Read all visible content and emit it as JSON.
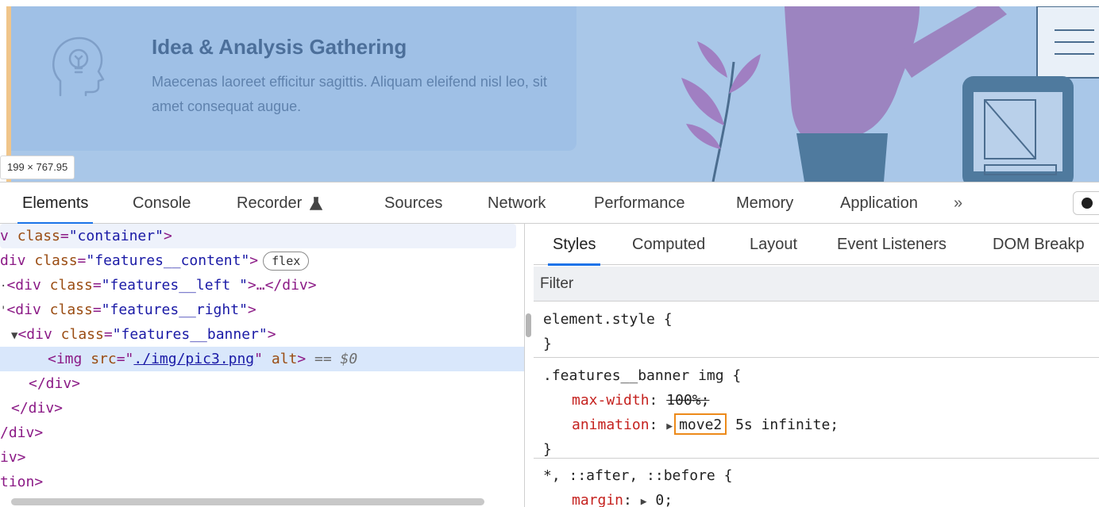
{
  "preview": {
    "card_title": "Idea & Analysis Gathering",
    "card_description": "Maecenas laoreet efficitur sagittis. Aliquam eleifend nisl leo, sit amet consequat augue.",
    "size_tooltip": "199 × 767.95"
  },
  "devtools": {
    "tabs": [
      {
        "label": "Elements",
        "active": true
      },
      {
        "label": "Console"
      },
      {
        "label": "Recorder"
      },
      {
        "label": "Sources"
      },
      {
        "label": "Network"
      },
      {
        "label": "Performance"
      },
      {
        "label": "Memory"
      },
      {
        "label": "Application"
      }
    ],
    "more_tabs": "»",
    "elements_tree": {
      "line1": {
        "prefix": "v ",
        "attr": "class",
        "value": "\"container\"",
        "close": ">"
      },
      "line2": {
        "tag": "div",
        "attr": "class",
        "value": "\"features__content\"",
        "close": ">",
        "badge": "flex"
      },
      "line3": {
        "arrow": "·",
        "tag": "<div",
        "attr": "class",
        "value": "\"features__left \"",
        "rest": ">…</div>"
      },
      "line4": {
        "arrow": "'",
        "tag": "<div",
        "attr": "class",
        "value": "\"features__right\"",
        "close": ">"
      },
      "line5": {
        "arrow": "▼",
        "tag": "<div",
        "attr": "class",
        "value": "\"features__banner\"",
        "close": ">"
      },
      "line6": {
        "tag": "<img",
        "attr_src": "src",
        "src_value": "./img/pic3.png",
        "attr_alt": "alt",
        "close": ">",
        "eq": "== $0"
      },
      "line7": "</div>",
      "line8": "</div>",
      "line9": "/div>",
      "line10": "iv>",
      "line11": "tion>"
    },
    "styles_pane": {
      "subtabs": [
        "Styles",
        "Computed",
        "Layout",
        "Event Listeners",
        "DOM Breakp"
      ],
      "filter_placeholder": "Filter",
      "rule1": {
        "selector": "element.style",
        "open": " {",
        "close": "}"
      },
      "rule2": {
        "selector": ".features__banner img",
        "open": " {",
        "decl1_prop": "max-width",
        "decl1_value": "100%;",
        "decl2_prop": "animation",
        "decl2_name": "move2",
        "decl2_rest": " 5s infinite;",
        "close": "}"
      },
      "rule3": {
        "selector": "*, ::after, ::before",
        "open": " {",
        "decl1_prop": "margin",
        "decl1_value": "0;"
      }
    }
  }
}
